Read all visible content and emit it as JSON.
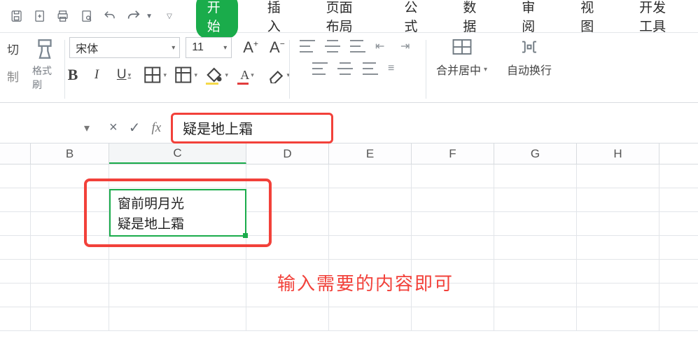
{
  "qat": {
    "icons": [
      "save-icon",
      "new-icon",
      "print-icon",
      "preview-icon",
      "undo-icon",
      "redo-icon"
    ]
  },
  "tabs": {
    "items": [
      "开始",
      "插入",
      "页面布局",
      "公式",
      "数据",
      "审阅",
      "视图",
      "开发工具"
    ],
    "active_index": 0
  },
  "ribbon": {
    "clipboard": {
      "cut": "切",
      "copy": "制",
      "format_painter": "格式刷"
    },
    "font": {
      "name": "宋体",
      "size": "11",
      "increase": "A⁺",
      "decrease": "A⁻"
    },
    "merge": {
      "label": "合并居中"
    },
    "wrap": {
      "label": "自动换行"
    }
  },
  "formula_bar": {
    "cancel": "×",
    "confirm": "✓",
    "fx": "fx",
    "value": "疑是地上霜"
  },
  "grid": {
    "columns": [
      "",
      "B",
      "C",
      "D",
      "E",
      "F",
      "G",
      "H"
    ],
    "selected_col": 2,
    "active_cell": {
      "line1": "窗前明月光",
      "line2": "疑是地上霜"
    }
  },
  "annotation": "输入需要的内容即可"
}
